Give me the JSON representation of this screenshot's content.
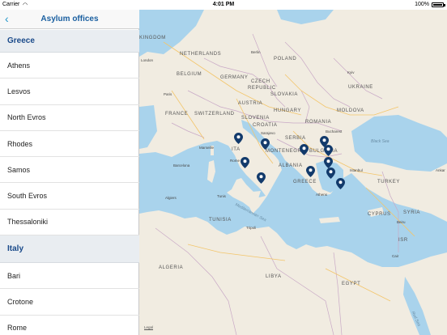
{
  "status_bar": {
    "carrier": "Carrier",
    "wifi_icon": "wifi-icon",
    "time": "4:01 PM",
    "battery": "100%"
  },
  "navbar": {
    "back_icon": "chevron-left-icon",
    "title": "Asylum offices"
  },
  "sections": [
    {
      "name": "Greece",
      "items": [
        "Athens",
        "Lesvos",
        "North Evros",
        "Rhodes",
        "Samos",
        "South Evros",
        "Thessaloniki"
      ]
    },
    {
      "name": "Italy",
      "items": [
        "Bari",
        "Crotone",
        "Rome"
      ]
    }
  ],
  "map": {
    "colors": {
      "sea": "#a9d3ec",
      "land": "#f1ece1",
      "border": "#c9a9c6",
      "road": "#f3c56a",
      "pin": "#123a6b"
    },
    "countries": {
      "kingdom": "KINGDOM",
      "netherlands": "NETHERLANDS",
      "berlin": "Berlin",
      "poland": "POLAND",
      "london": "London",
      "belgium": "BELGIUM",
      "germany": "GERMANY",
      "ukraine_kyiv": "Kyiv",
      "ukraine": "UKRAINE",
      "paris": "Paris",
      "czech1": "CZECH",
      "czech2": "REPUBLIC",
      "slovakia": "SLOVAKIA",
      "moldova": "MOLDOVA",
      "austria": "AUSTRIA",
      "hungary": "HUNGARY",
      "france": "FRANCE",
      "switzerland": "SWITZERLAND",
      "slovenia": "SLOVENIA",
      "croatia": "CROATIA",
      "romania": "ROMANIA",
      "bucharest": "Bucharest",
      "sarajevo": "Sarajevo",
      "serbia": "SERBIA",
      "black_sea": "Black Sea",
      "marseille": "Marseille",
      "montenegro": "MONTENEGRO",
      "bulgaria": "BULGARIA",
      "barcelona": "Barcelona",
      "italy": "ITA",
      "rome": "Rome",
      "albania": "ALBANIA",
      "istanbul": "Istanbul",
      "ankara": "Ankar",
      "greece": "GREECE",
      "turkey": "TURKEY",
      "athens_city": "Athens",
      "algiers": "Algiers",
      "tunis": "Tunis",
      "med_sea": "Mediterranean Sea",
      "cyprus": "CYPRUS",
      "syria": "SYRIA",
      "beirut": "Beiru",
      "tunisia": "TUNISIA",
      "tripoli": "Tripoli",
      "israel": "ISR",
      "cairo": "Cair",
      "algeria": "ALGERIA",
      "libya": "LIBYA",
      "egypt": "EGYPT",
      "red_sea": "Red Sea",
      "legal": "Legal"
    },
    "pins": [
      "map-pin-icon"
    ]
  }
}
